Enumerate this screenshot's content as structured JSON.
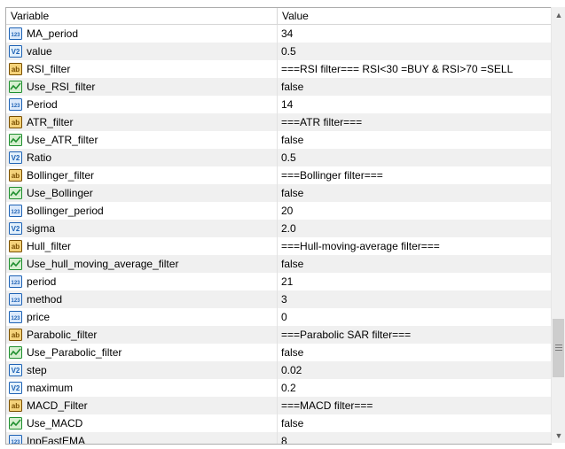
{
  "header": {
    "variable": "Variable",
    "value": "Value"
  },
  "type_icons": {
    "int": {
      "icon": "int-icon",
      "text": "123",
      "fg": "#1f63b5",
      "bg": "#dbe9fb"
    },
    "dbl": {
      "icon": "double-icon",
      "text": "V2",
      "fg": "#1f63b5",
      "bg": "#e2f0fb"
    },
    "str": {
      "icon": "string-icon",
      "text": "ab",
      "fg": "#7a4f00",
      "bg": "#f4d27a"
    },
    "bool": {
      "icon": "bool-icon",
      "fg": "#1f8f2f",
      "bg": "#d6efd0"
    }
  },
  "rows": [
    {
      "type": "int",
      "name": "MA_period",
      "value": "34"
    },
    {
      "type": "dbl",
      "name": "value",
      "value": "0.5"
    },
    {
      "type": "str",
      "name": "RSI_filter",
      "value": "===RSI filter=== RSI<30 =BUY & RSI>70 =SELL"
    },
    {
      "type": "bool",
      "name": "Use_RSI_filter",
      "value": "false"
    },
    {
      "type": "int",
      "name": "Period",
      "value": "14"
    },
    {
      "type": "str",
      "name": "ATR_filter",
      "value": "===ATR filter==="
    },
    {
      "type": "bool",
      "name": "Use_ATR_filter",
      "value": "false"
    },
    {
      "type": "dbl",
      "name": "Ratio",
      "value": "0.5"
    },
    {
      "type": "str",
      "name": "Bollinger_filter",
      "value": "===Bollinger filter==="
    },
    {
      "type": "bool",
      "name": "Use_Bollinger",
      "value": "false"
    },
    {
      "type": "int",
      "name": "Bollinger_period",
      "value": "20"
    },
    {
      "type": "dbl",
      "name": "sigma",
      "value": "2.0"
    },
    {
      "type": "str",
      "name": "Hull_filter",
      "value": "===Hull-moving-average filter==="
    },
    {
      "type": "bool",
      "name": "Use_hull_moving_average_filter",
      "value": "false"
    },
    {
      "type": "int",
      "name": "period",
      "value": "21"
    },
    {
      "type": "int",
      "name": "method",
      "value": "3"
    },
    {
      "type": "int",
      "name": "price",
      "value": "0"
    },
    {
      "type": "str",
      "name": "Parabolic_filter",
      "value": "===Parabolic SAR filter==="
    },
    {
      "type": "bool",
      "name": "Use_Parabolic_filter",
      "value": "false"
    },
    {
      "type": "dbl",
      "name": "step",
      "value": "0.02"
    },
    {
      "type": "dbl",
      "name": "maximum",
      "value": "0.2"
    },
    {
      "type": "str",
      "name": "MACD_Filter",
      "value": "===MACD filter==="
    },
    {
      "type": "bool",
      "name": "Use_MACD",
      "value": "false"
    },
    {
      "type": "int",
      "name": "InpFastEMA",
      "value": "8"
    }
  ],
  "scrollbar": {
    "up": "▲",
    "down": "▼"
  }
}
